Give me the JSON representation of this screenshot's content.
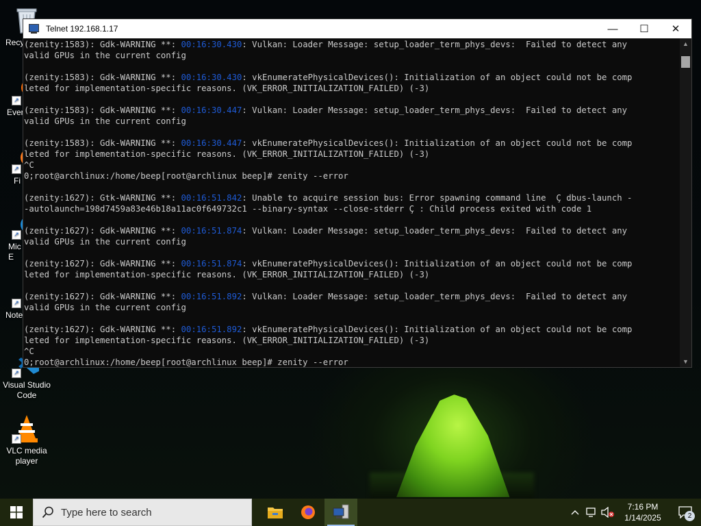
{
  "desktop": {
    "icons": [
      {
        "label": "Recy",
        "icon": "recycle-bin-icon"
      },
      {
        "label": "Ever",
        "icon": "everything-icon"
      },
      {
        "label": "Fi",
        "icon": "firefox-icon"
      },
      {
        "label": "Mic\nE",
        "icon": "edge-icon"
      },
      {
        "label": "Note",
        "icon": "notepad-icon"
      },
      {
        "label": "Visual Studio\nCode",
        "icon": "vscode-icon"
      },
      {
        "label": "VLC media\nplayer",
        "icon": "vlc-icon"
      }
    ]
  },
  "window": {
    "title": "Telnet 192.168.1.17",
    "minimize_glyph": "—",
    "maximize_glyph": "☐",
    "close_glyph": "✕",
    "lines": [
      {
        "pre": "(zenity:1583): Gdk-",
        "warn": "WARNING",
        "mid": " **: ",
        "ts": "00:16:30.430",
        "post": ": Vulkan: Loader Message: setup_loader_term_phys_devs:  Failed to detect any"
      },
      {
        "pre": "valid GPUs in the current config"
      },
      {
        "pre": ""
      },
      {
        "pre": "(zenity:1583): Gdk-",
        "warn": "WARNING",
        "mid": " **: ",
        "ts": "00:16:30.430",
        "post": ": vkEnumeratePhysicalDevices(): Initialization of an object could not be comp"
      },
      {
        "pre": "leted for implementation-specific reasons. (VK_ERROR_INITIALIZATION_FAILED) (-3)"
      },
      {
        "pre": ""
      },
      {
        "pre": "(zenity:1583): Gdk-",
        "warn": "WARNING",
        "mid": " **: ",
        "ts": "00:16:30.447",
        "post": ": Vulkan: Loader Message: setup_loader_term_phys_devs:  Failed to detect any"
      },
      {
        "pre": "valid GPUs in the current config"
      },
      {
        "pre": ""
      },
      {
        "pre": "(zenity:1583): Gdk-",
        "warn": "WARNING",
        "mid": " **: ",
        "ts": "00:16:30.447",
        "post": ": vkEnumeratePhysicalDevices(): Initialization of an object could not be comp"
      },
      {
        "pre": "leted for implementation-specific reasons. (VK_ERROR_INITIALIZATION_FAILED) (-3)"
      },
      {
        "pre": "^C"
      },
      {
        "pre": "0;root@archlinux:/home/beep[root@archlinux beep]# zenity --error"
      },
      {
        "pre": ""
      },
      {
        "pre": "(zenity:1627): Gtk-",
        "warn": "WARNING",
        "mid": " **: ",
        "ts": "00:16:51.842",
        "post": ": Unable to acquire session bus: Error spawning command line  Ç dbus-launch -"
      },
      {
        "pre": "-autolaunch=198d7459a83e46b18a11ac0f649732c1 --binary-syntax --close-stderr Ç : Child process exited with code 1"
      },
      {
        "pre": ""
      },
      {
        "pre": "(zenity:1627): Gdk-",
        "warn": "WARNING",
        "mid": " **: ",
        "ts": "00:16:51.874",
        "post": ": Vulkan: Loader Message: setup_loader_term_phys_devs:  Failed to detect any"
      },
      {
        "pre": "valid GPUs in the current config"
      },
      {
        "pre": ""
      },
      {
        "pre": "(zenity:1627): Gdk-",
        "warn": "WARNING",
        "mid": " **: ",
        "ts": "00:16:51.874",
        "post": ": vkEnumeratePhysicalDevices(): Initialization of an object could not be comp"
      },
      {
        "pre": "leted for implementation-specific reasons. (VK_ERROR_INITIALIZATION_FAILED) (-3)"
      },
      {
        "pre": ""
      },
      {
        "pre": "(zenity:1627): Gdk-",
        "warn": "WARNING",
        "mid": " **: ",
        "ts": "00:16:51.892",
        "post": ": Vulkan: Loader Message: setup_loader_term_phys_devs:  Failed to detect any"
      },
      {
        "pre": "valid GPUs in the current config"
      },
      {
        "pre": ""
      },
      {
        "pre": "(zenity:1627): Gdk-",
        "warn": "WARNING",
        "mid": " **: ",
        "ts": "00:16:51.892",
        "post": ": vkEnumeratePhysicalDevices(): Initialization of an object could not be comp"
      },
      {
        "pre": "leted for implementation-specific reasons. (VK_ERROR_INITIALIZATION_FAILED) (-3)"
      },
      {
        "pre": "^C"
      },
      {
        "pre": "0;root@archlinux:/home/beep[root@archlinux beep]# zenity --error"
      }
    ]
  },
  "taskbar": {
    "search_placeholder": "Type here to search",
    "apps": [
      {
        "name": "file-explorer",
        "icon": "folder-icon"
      },
      {
        "name": "firefox",
        "icon": "firefox-icon"
      },
      {
        "name": "telnet",
        "icon": "telnet-icon",
        "active": true
      }
    ],
    "time": "7:16 PM",
    "date": "1/14/2025",
    "notification_count": "2"
  },
  "colors": {
    "timestamp": "#1f5bd6",
    "console_bg": "#0c0c0c",
    "console_text": "#cccccc",
    "taskbar_bg": "#1e260e"
  }
}
